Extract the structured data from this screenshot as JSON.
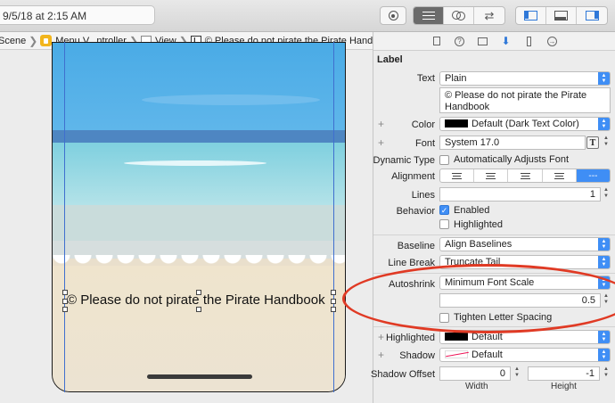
{
  "toolbar": {
    "status_text": "9/5/18 at 2:15 AM"
  },
  "jumpbar": {
    "items": [
      "Scene",
      "Menu V...ntroller",
      "View",
      "© Please do not pirate the Pirate Handbook"
    ]
  },
  "canvas": {
    "label_text": "© Please do not pirate the Pirate Handbook"
  },
  "inspector": {
    "section_label": "Label",
    "text": {
      "label": "Text",
      "value": "Plain",
      "content": "© Please do not pirate the Pirate Handbook"
    },
    "color": {
      "label": "Color",
      "value": "Default (Dark Text Color)"
    },
    "font": {
      "label": "Font",
      "value": "System 17.0"
    },
    "dynamic_type": {
      "label": "Dynamic Type",
      "option": "Automatically Adjusts Font"
    },
    "alignment": {
      "label": "Alignment",
      "selected": "---"
    },
    "lines": {
      "label": "Lines",
      "value": "1"
    },
    "behavior": {
      "label": "Behavior",
      "enabled": "Enabled",
      "highlighted": "Highlighted"
    },
    "baseline": {
      "label": "Baseline",
      "value": "Align Baselines"
    },
    "line_break": {
      "label": "Line Break",
      "value": "Truncate Tail"
    },
    "autoshrink": {
      "label": "Autoshrink",
      "value": "Minimum Font Scale",
      "scale": "0.5",
      "tighten": "Tighten Letter Spacing"
    },
    "highlighted": {
      "label": "Highlighted",
      "value": "Default"
    },
    "shadow": {
      "label": "Shadow",
      "value": "Default"
    },
    "shadow_offset": {
      "label": "Shadow Offset",
      "width": "0",
      "height": "-1",
      "width_label": "Width",
      "height_label": "Height"
    }
  },
  "colors": {
    "accent": "#3f8ef5",
    "annotation": "#e03a24"
  }
}
